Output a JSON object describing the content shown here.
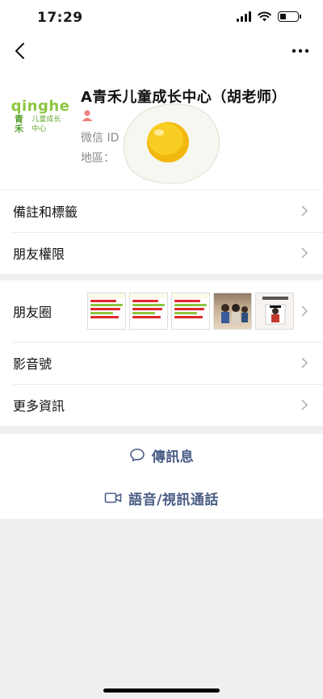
{
  "status_bar": {
    "time": "17:29"
  },
  "profile": {
    "name": "A青禾儿童成长中心（胡老师）",
    "wechat_id_label": "微信 ID",
    "region_label": "地區：",
    "avatar_text": "qinghe",
    "avatar_subtitle": "青禾",
    "avatar_tagline": "儿童成长中心"
  },
  "settings": {
    "notes_tags": "備註和標籤",
    "friend_permissions": "朋友權限"
  },
  "details": {
    "moments": "朋友圈",
    "channels": "影音號",
    "more_info": "更多資訊"
  },
  "actions": {
    "send_message": "傳訊息",
    "voice_video_call": "語音/視訊通話"
  },
  "colors": {
    "action_text": "#4a5d86",
    "avatar_green": "#8cc63f",
    "gender_icon": "#f08080"
  }
}
